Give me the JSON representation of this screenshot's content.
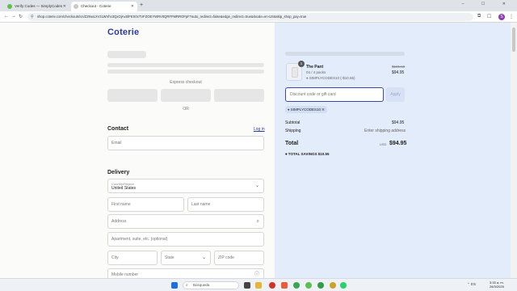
{
  "browser": {
    "tabs": [
      {
        "title": "Verify Codes — SimplyCodes",
        "active": false
      },
      {
        "title": "Checkout - Coterie",
        "active": true
      }
    ],
    "new_tab": "+",
    "url": "shop.coterie.com/checkouts/cn/Z2NwLXVzLWVhc3QxOjAxSlFEX0xTVFZOEYWRV0QRFFMRROFpF?auto_redirect=false&edge_redirect=true&locale=en-US&skip_shop_pay=true",
    "profile_initial": "S",
    "window_controls": "– ☐ ✕"
  },
  "checkout": {
    "brand": "Coterie",
    "express_label": "Express checkout",
    "or_label": "OR",
    "contact": {
      "heading": "Contact",
      "login_link": "Log in",
      "email_placeholder": "Email"
    },
    "delivery": {
      "heading": "Delivery",
      "country_label": "Country/Region",
      "country_value": "United States",
      "first_name": "First name",
      "last_name": "Last name",
      "address": "Address",
      "apartment": "Apartment, suite, etc. (optional)",
      "city": "City",
      "state": "State",
      "zip": "ZIP code",
      "phone": "Mobile number"
    }
  },
  "summary": {
    "item": {
      "quantity": "1",
      "name": "The Pant",
      "variant": "04 / 4 packs",
      "discount_line": "SIMPLYCODES10 (-$10.55)",
      "original_price": "$105.50",
      "price": "$94.95"
    },
    "discount_placeholder": "Discount code or gift card",
    "apply_label": "Apply",
    "code_chip": "SIMPLYCODES10",
    "subtotal_label": "Subtotal",
    "subtotal_value": "$94.95",
    "shipping_label": "Shipping",
    "shipping_value": "Enter shipping address",
    "total_label": "Total",
    "currency": "USD",
    "total_value": "$94.95",
    "savings_label": "TOTAL SAVINGS",
    "savings_value": "$10.55",
    "accent_color": "#2a3aa8",
    "panel_color": "#e3ecfa"
  },
  "taskbar": {
    "search_placeholder": "Búsqueda",
    "language": "ES",
    "time": "3:33 a. m.",
    "date": "28/3/2025"
  }
}
